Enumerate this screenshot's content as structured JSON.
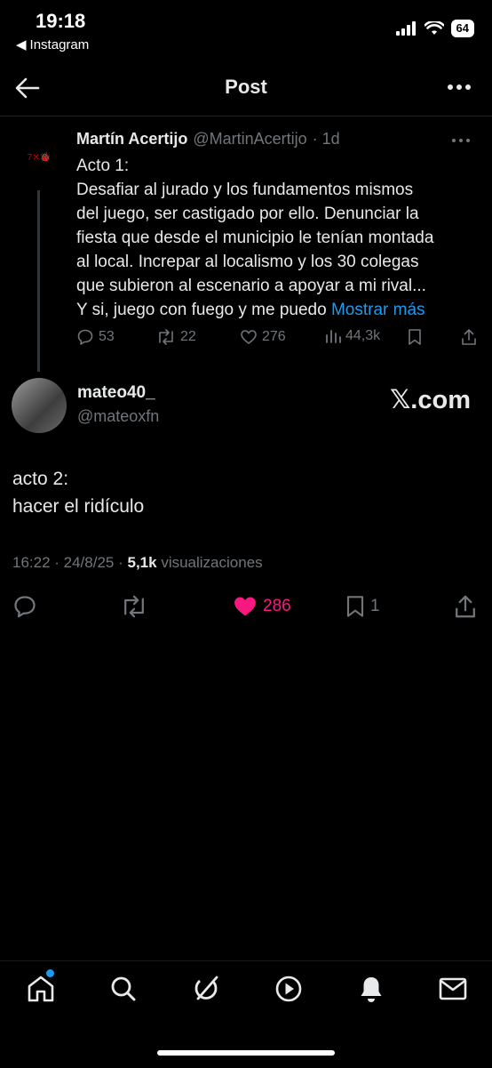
{
  "status_bar": {
    "time": "19:18",
    "back_app": "Instagram",
    "battery": "64"
  },
  "header": {
    "title": "Post"
  },
  "quoted_post": {
    "avatar_text": "7✕🐞",
    "name": "Martín Acertijo",
    "handle": "@MartinAcertijo",
    "time": "· 1d",
    "body_lines": [
      "Acto 1:",
      "Desafiar al jurado y los fundamentos mismos",
      "del juego, ser castigado por ello. Denunciar la",
      "fiesta que desde el municipio le tenían montada",
      "al local. Increpar al localismo y los 30 colegas",
      "que subieron al escenario a apoyar a mi rival...",
      "Y si, juego con fuego y me puedo"
    ],
    "show_more": "Mostrar más",
    "replies": "53",
    "reposts": "22",
    "likes": "276",
    "views": "44,3k"
  },
  "main_post": {
    "name": "mateo40_",
    "handle": "@mateoxfn",
    "watermark": "𝕏.com",
    "text_lines": [
      "acto 2:",
      "hacer el ridículo"
    ],
    "timestamp": "16:22 · 24/8/25 · ",
    "views_count": "5,1k",
    "views_label": "visualizaciones",
    "likes": "286",
    "bookmarks": "1"
  },
  "colors": {
    "background": "#000000",
    "text": "#e7e9ea",
    "muted": "#71767b",
    "link": "#1d9bf0",
    "like": "#f91880"
  },
  "nav": {
    "icons": [
      "home-icon",
      "search-icon",
      "grok-icon",
      "video-icon",
      "notifications-icon",
      "messages-icon"
    ]
  }
}
